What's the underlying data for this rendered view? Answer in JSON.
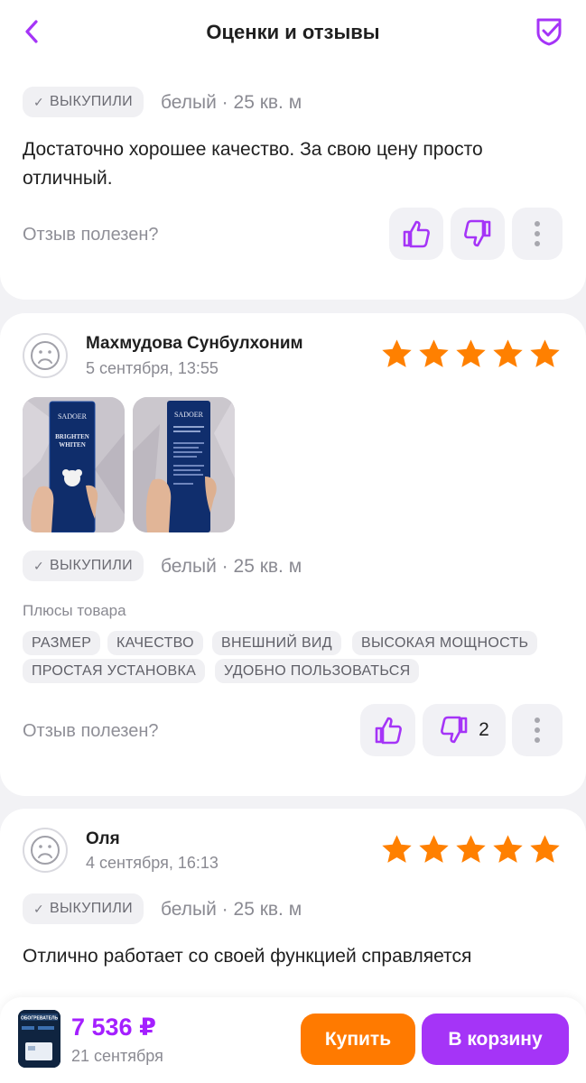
{
  "header": {
    "title": "Оценки и отзывы"
  },
  "colors": {
    "accent": "#a534f7",
    "price": "#a41fff",
    "star": "#ff8000",
    "buy": "#ff7a00"
  },
  "reviews": [
    {
      "purchased_badge": "ВЫКУПИЛИ",
      "variant": "белый · 25 кв. м",
      "text": "Достаточно хорошее качество. За свою цену просто отличный.",
      "helpful_label": "Отзыв полезен?",
      "likes": "",
      "dislikes": ""
    },
    {
      "author": "Махмудова Сунбулхоним",
      "date": "5 сентября, 13:55",
      "rating": 5,
      "photos": [
        {
          "brand": "SADOER",
          "line1": "BRIGHTEN",
          "line2": "WHITEN"
        },
        {
          "brand": "SADOER"
        }
      ],
      "purchased_badge": "ВЫКУПИЛИ",
      "variant": "белый · 25 кв. м",
      "pluses_label": "Плюсы товара",
      "tags": [
        "РАЗМЕР",
        "КАЧЕСТВО",
        "ВНЕШНИЙ ВИД",
        "ВЫСОКАЯ МОЩНОСТЬ",
        "ПРОСТАЯ УСТАНОВКА",
        "УДОБНО ПОЛЬЗОВАТЬСЯ"
      ],
      "helpful_label": "Отзыв полезен?",
      "dislikes": "2"
    },
    {
      "author": "Оля",
      "date": "4 сентября, 16:13",
      "rating": 5,
      "purchased_badge": "ВЫКУПИЛИ",
      "variant": "белый · 25 кв. м",
      "text": "Отлично работает со своей функцией справляется"
    }
  ],
  "bottom_bar": {
    "price": "7 536 ₽",
    "delivery_date": "21 сентября",
    "buy_label": "Купить",
    "cart_label": "В корзину",
    "thumb_text": "ОБОГРЕВАТЕЛЬ"
  }
}
